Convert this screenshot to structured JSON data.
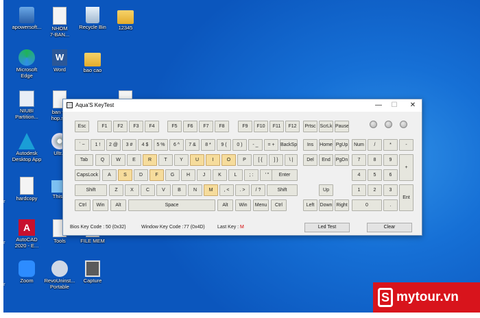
{
  "desktop_icons": [
    {
      "name": "apowersoft-icon",
      "label": "apowersoft..."
    },
    {
      "name": "nhom-doc-icon",
      "label": "NHOM\n7-BAN..."
    },
    {
      "name": "recycle-bin-icon",
      "label": "Recycle Bin"
    },
    {
      "name": "folder-12345-icon",
      "label": "12345"
    },
    {
      "name": "edge-icon",
      "label": "Microsoft\nEdge"
    },
    {
      "name": "word-icon",
      "label": "Word"
    },
    {
      "name": "bao-cao-folder-icon",
      "label": "bao cao"
    },
    {
      "name": "niubi-icon",
      "label": "NIUBI\nPartition..."
    },
    {
      "name": "ban-ve-doc-icon",
      "label": "ban ve\nhop.s..."
    },
    {
      "name": "autodesk-icon",
      "label": "Autodesk\nDesktop App"
    },
    {
      "name": "ultraiso-icon",
      "label": "Ultr..."
    },
    {
      "name": "hardcopy-icon",
      "label": "hardcopy"
    },
    {
      "name": "this-pc-icon",
      "label": "This..."
    },
    {
      "name": "autocad-icon",
      "label": "AutoCAD\n2020 - E..."
    },
    {
      "name": "tools-icon",
      "label": "Tools"
    },
    {
      "name": "file-mem-icon",
      "label": "FILE MEM"
    },
    {
      "name": "zoom-icon",
      "label": "Zoom"
    },
    {
      "name": "revo-icon",
      "label": "RevoUninst...\nPortable"
    },
    {
      "name": "capture-icon",
      "label": "Capture"
    },
    {
      "name": "edge-left-1",
      "label": "er"
    },
    {
      "name": "edge-left-2",
      "label": "er"
    },
    {
      "name": "edge-left-3",
      "label": "er"
    }
  ],
  "window": {
    "title": "Aqua'S KeyTest",
    "minimize": "—",
    "maximize": "☐",
    "close": "✕"
  },
  "keys": {
    "esc": "Esc",
    "f1": "F1",
    "f2": "F2",
    "f3": "F3",
    "f4": "F4",
    "f5": "F5",
    "f6": "F6",
    "f7": "F7",
    "f8": "F8",
    "f9": "F9",
    "f10": "F10",
    "f11": "F11",
    "f12": "F12",
    "prtsc": "Prtsc",
    "scrlk": "ScrLk",
    "pause": "Pause",
    "tilde": "` ~",
    "k1": "1 !",
    "k2": "2 @",
    "k3": "3 #",
    "k4": "4 $",
    "k5": "5 %",
    "k6": "6 ^",
    "k7": "7 &",
    "k8": "8 *",
    "k9": "9 (",
    "k0": "0 )",
    "minus": "- _",
    "equals": "= +",
    "backspace": "BackSpace",
    "ins": "Ins",
    "home": "Home",
    "pgup": "PgUp",
    "num": "Num",
    "ndiv": "/",
    "nmul": "*",
    "nminus": "-",
    "tab": "Tab",
    "q": "Q",
    "w": "W",
    "e": "E",
    "r": "R",
    "t": "T",
    "y": "Y",
    "u": "U",
    "i": "I",
    "o": "O",
    "p": "P",
    "lbr": "[ {",
    "rbr": "] }",
    "bslash": "\\ |",
    "del": "Del",
    "end": "End",
    "pgdn": "PgDn",
    "n7": "7",
    "n8": "8",
    "n9": "9",
    "nplus": "+",
    "caps": "CapsLock",
    "a": "A",
    "s": "S",
    "d": "D",
    "f": "F",
    "g": "G",
    "h": "H",
    "j": "J",
    "k": "K",
    "l": "L",
    "semi": "; :",
    "quote": "' \"",
    "enter": "Enter",
    "n4": "4",
    "n5": "5",
    "n6": "6",
    "lshift": "Shift",
    "z": "Z",
    "x": "X",
    "c": "C",
    "v": "V",
    "b": "B",
    "n": "N",
    "m": "M",
    "comma": ", <",
    "period": ". >",
    "slash": "/ ?",
    "rshift": "Shift",
    "up": "Up",
    "n1": "1",
    "n2": "2",
    "n3": "3",
    "nent": "Ent",
    "lctrl": "Ctrl",
    "lwin": "Win",
    "lalt": "Alt",
    "space": "Space",
    "ralt": "Alt",
    "rwin": "Win",
    "menu": "Menu",
    "rctrl": "Ctrl",
    "left": "Left",
    "down": "Down",
    "right": "Right",
    "n0": "0",
    "ndot": "."
  },
  "highlighted_keys": [
    "r",
    "u",
    "o",
    "s",
    "f",
    "m",
    "i"
  ],
  "status": {
    "bios_label": "Bios Key Code :",
    "bios_value": "50 (0x32)",
    "window_label": "Window Key Code :",
    "window_value": "77 (0x4D)",
    "last_label": "Last Key :",
    "last_value": "M",
    "led_test": "Led Test",
    "clear": "Clear"
  },
  "brand": {
    "letter": "S",
    "text": "mytour.vn"
  },
  "colors": {
    "highlight": "#f6dc9c",
    "last_key": "#d40000",
    "brand": "#d8141c"
  }
}
